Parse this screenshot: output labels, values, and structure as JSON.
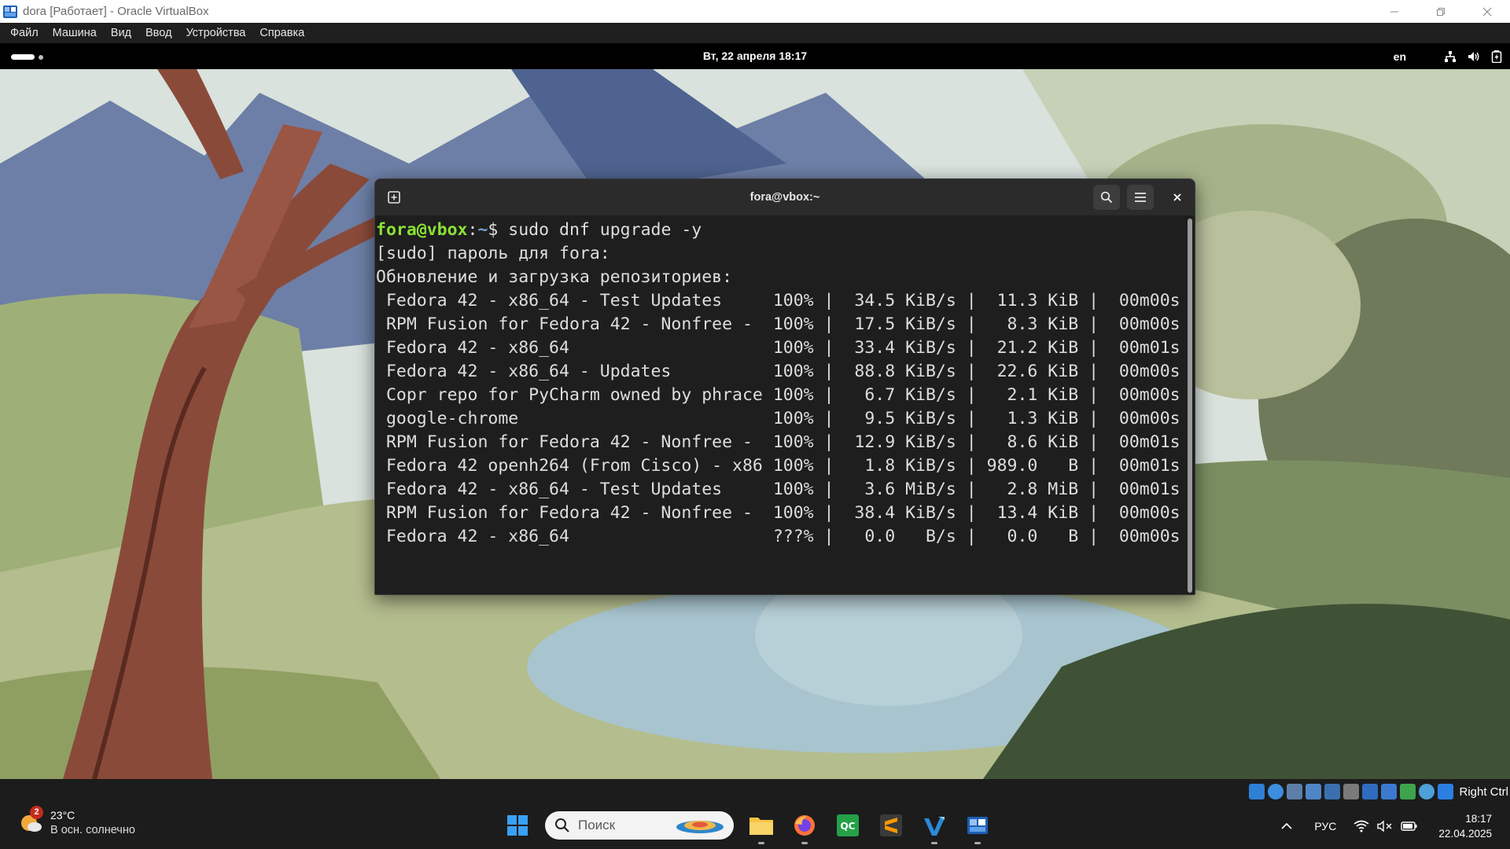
{
  "host_window": {
    "title": "dora [Работает] - Oracle VirtualBox",
    "controls": [
      "minimize",
      "restore",
      "close"
    ]
  },
  "menubar": {
    "items": [
      "Файл",
      "Машина",
      "Вид",
      "Ввод",
      "Устройства",
      "Справка"
    ]
  },
  "gnome_topbar": {
    "clock": "Вт, 22 апреля  18:17",
    "keyboard_layout": "en",
    "tray_icons": [
      "network-icon",
      "volume-icon",
      "battery-icon"
    ]
  },
  "terminal": {
    "title": "fora@vbox:~",
    "prompt_user": "fora@vbox",
    "prompt_sep": ":",
    "prompt_path": "~",
    "prompt_symbol": "$ ",
    "command": "sudo dnf upgrade -y",
    "lines": [
      "[sudo] пароль для fora:",
      "Обновление и загрузка репозиториев:",
      " Fedora 42 - x86_64 - Test Updates     100% |  34.5 KiB/s |  11.3 KiB |  00m00s",
      " RPM Fusion for Fedora 42 - Nonfree -  100% |  17.5 KiB/s |   8.3 KiB |  00m00s",
      " Fedora 42 - x86_64                    100% |  33.4 KiB/s |  21.2 KiB |  00m01s",
      " Fedora 42 - x86_64 - Updates          100% |  88.8 KiB/s |  22.6 KiB |  00m00s",
      " Copr repo for PyCharm owned by phrace 100% |   6.7 KiB/s |   2.1 KiB |  00m00s",
      " google-chrome                         100% |   9.5 KiB/s |   1.3 KiB |  00m00s",
      " RPM Fusion for Fedora 42 - Nonfree -  100% |  12.9 KiB/s |   8.6 KiB |  00m01s",
      " Fedora 42 openh264 (From Cisco) - x86 100% |   1.8 KiB/s | 989.0   B |  00m01s",
      " Fedora 42 - x86_64 - Test Updates     100% |   3.6 MiB/s |   2.8 MiB |  00m01s",
      " RPM Fusion for Fedora 42 - Nonfree -  100% |  38.4 KiB/s |  13.4 KiB |  00m00s",
      " Fedora 42 - x86_64                    ???% |   0.0   B/s |   0.0   B |  00m00s"
    ]
  },
  "vbox_status": {
    "host_key": "Right Ctrl"
  },
  "taskbar": {
    "weather_temp": "23°C",
    "weather_desc": "В осн. солнечно",
    "weather_badge": "2",
    "search_placeholder": "Поиск",
    "lang": "РУС",
    "time": "18:17",
    "date": "22.04.2025",
    "pinned_apps": [
      "start-icon",
      "file-explorer-icon",
      "firefox-icon",
      "qc-icon",
      "sublime-icon",
      "visual-studio-icon",
      "virtualbox-icon"
    ]
  },
  "colors": {
    "terminal_bg": "#1e1e1e",
    "prompt_user": "#8ae234",
    "prompt_path": "#729fcf",
    "taskbar_bg": "#1c1c1c"
  }
}
